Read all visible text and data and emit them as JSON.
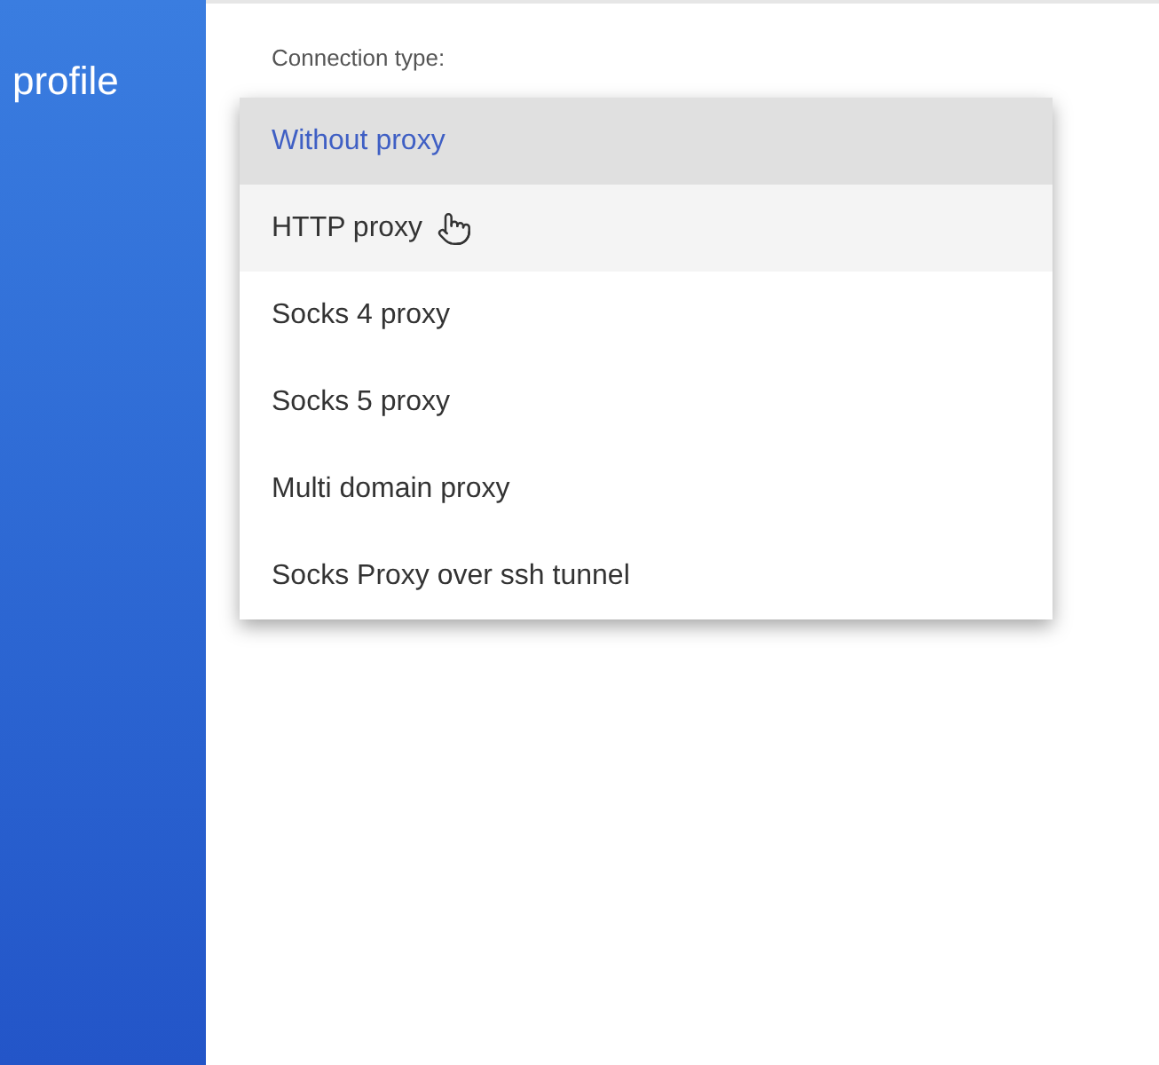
{
  "sidebar": {
    "title": "profile"
  },
  "connection_type": {
    "label": "Connection type:",
    "options": [
      {
        "label": "Without proxy",
        "selected": true,
        "hovered": false
      },
      {
        "label": "HTTP proxy",
        "selected": false,
        "hovered": true
      },
      {
        "label": "Socks 4 proxy",
        "selected": false,
        "hovered": false
      },
      {
        "label": "Socks 5 proxy",
        "selected": false,
        "hovered": false
      },
      {
        "label": "Multi domain proxy",
        "selected": false,
        "hovered": false
      },
      {
        "label": "Socks Proxy over ssh tunnel",
        "selected": false,
        "hovered": false
      }
    ]
  }
}
